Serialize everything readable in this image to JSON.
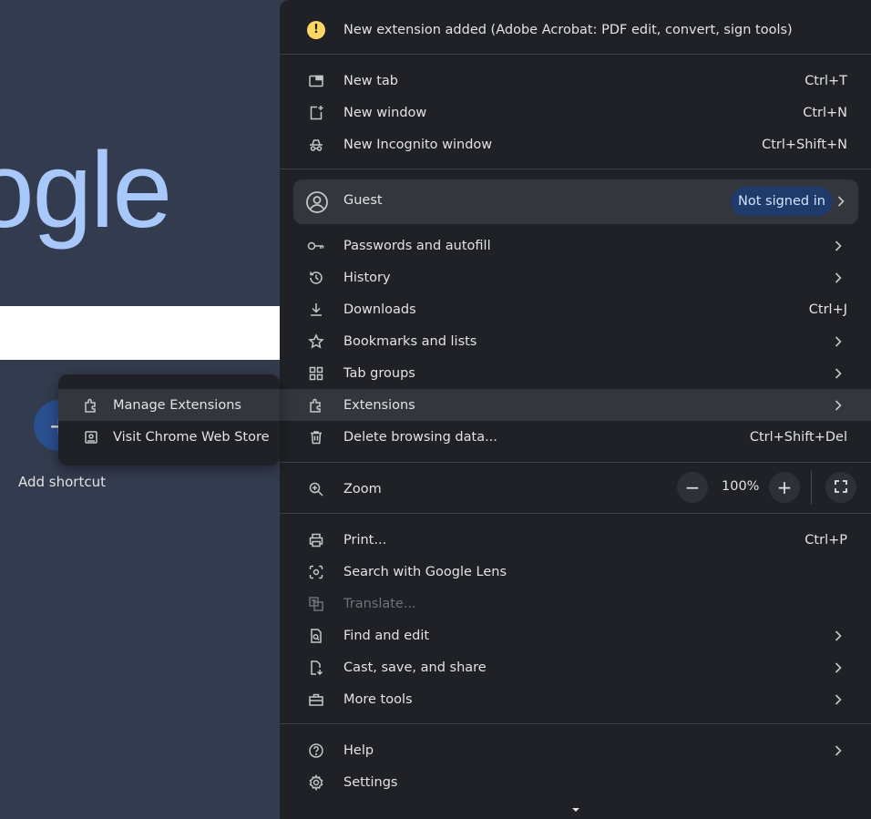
{
  "background": {
    "logo_text": "ogle",
    "shortcut_label": "Add shortcut",
    "shortcut_glyph": "+"
  },
  "submenu": {
    "items": [
      {
        "label": "Manage Extensions",
        "icon": "puzzle-icon"
      },
      {
        "label": "Visit Chrome Web Store",
        "icon": "web-store-icon"
      }
    ]
  },
  "menu": {
    "notice": "New extension added (Adobe Acrobat: PDF edit, convert, sign tools)",
    "notice_icon": "!",
    "section1": [
      {
        "label": "New tab",
        "shortcut": "Ctrl+T",
        "icon": "new-tab-icon"
      },
      {
        "label": "New window",
        "shortcut": "Ctrl+N",
        "icon": "new-window-icon"
      },
      {
        "label": "New Incognito window",
        "shortcut": "Ctrl+Shift+N",
        "icon": "incognito-icon"
      }
    ],
    "profile": {
      "label": "Guest",
      "badge": "Not signed in",
      "icon": "account-icon"
    },
    "section2": [
      {
        "label": "Passwords and autofill",
        "icon": "key-icon",
        "submenu": true
      },
      {
        "label": "History",
        "icon": "history-icon",
        "submenu": true
      },
      {
        "label": "Downloads",
        "shortcut": "Ctrl+J",
        "icon": "download-icon"
      },
      {
        "label": "Bookmarks and lists",
        "icon": "star-icon",
        "submenu": true
      },
      {
        "label": "Tab groups",
        "icon": "tab-groups-icon",
        "submenu": true
      },
      {
        "label": "Extensions",
        "icon": "puzzle-icon",
        "submenu": true,
        "highlighted": true
      },
      {
        "label": "Delete browsing data...",
        "shortcut": "Ctrl+Shift+Del",
        "icon": "trash-icon"
      }
    ],
    "zoom": {
      "label": "Zoom",
      "value": "100%",
      "minus": "−",
      "plus": "+"
    },
    "section3": [
      {
        "label": "Print...",
        "shortcut": "Ctrl+P",
        "icon": "print-icon"
      },
      {
        "label": "Search with Google Lens",
        "icon": "lens-icon"
      },
      {
        "label": "Translate...",
        "icon": "translate-icon",
        "disabled": true
      },
      {
        "label": "Find and edit",
        "icon": "find-icon",
        "submenu": true
      },
      {
        "label": "Cast, save, and share",
        "icon": "cast-save-icon",
        "submenu": true
      },
      {
        "label": "More tools",
        "icon": "toolbox-icon",
        "submenu": true
      }
    ],
    "section4": [
      {
        "label": "Help",
        "icon": "help-icon",
        "submenu": true
      },
      {
        "label": "Settings",
        "icon": "gear-icon"
      }
    ]
  },
  "colors": {
    "menu_bg": "#1f2126",
    "highlight": "#33363d",
    "badge_bg": "#1f3b6b",
    "logo": "#a8c7fa",
    "warning": "#fdd663"
  }
}
